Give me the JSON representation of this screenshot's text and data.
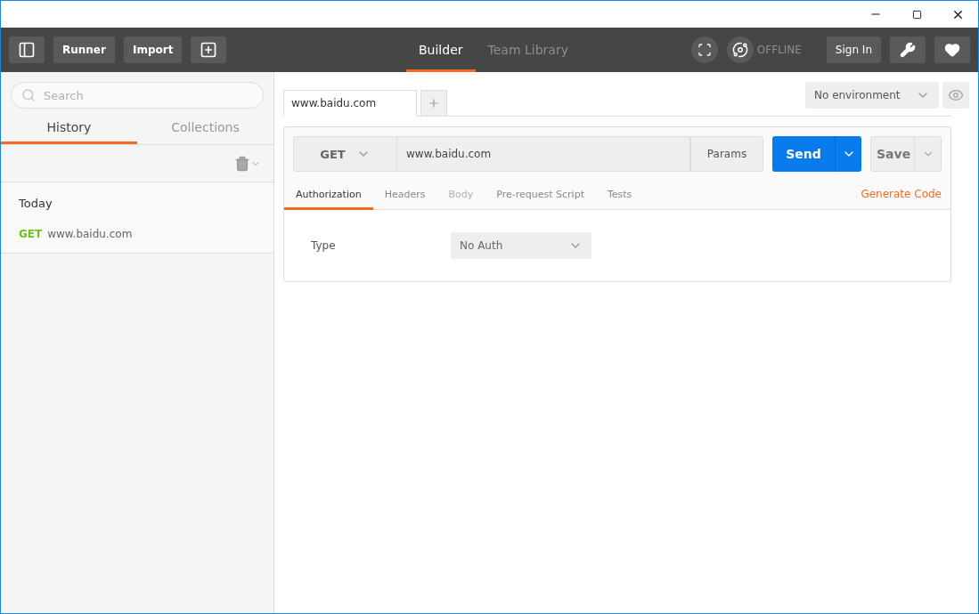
{
  "toolbar": {
    "buttons": [
      "Runner",
      "Import"
    ],
    "nav_tabs": [
      {
        "label": "Builder",
        "selected": true
      },
      {
        "label": "Team Library",
        "selected": false
      }
    ],
    "status": "OFFLINE",
    "sign_in": "Sign In"
  },
  "sidebar": {
    "search": {
      "placeholder": "Search"
    },
    "tabs": [
      {
        "label": "History",
        "selected": true
      },
      {
        "label": "Collections",
        "selected": false
      }
    ],
    "history": [
      {
        "label": "Today",
        "items": [
          {
            "method": "GET",
            "url": "www.baidu.com"
          }
        ]
      }
    ]
  },
  "request_tabs": [
    {
      "label": "www.baidu.com",
      "selected": true
    }
  ],
  "environment": "No environment",
  "request": {
    "method": "GET",
    "url": "www.baidu.com",
    "params": "Params",
    "send": "Send",
    "save": "Save",
    "tabs": [
      {
        "label": "Authorization",
        "selected": true,
        "disabled": false
      },
      {
        "label": "Headers",
        "selected": false,
        "disabled": false
      },
      {
        "label": "Body",
        "selected": false,
        "disabled": true
      },
      {
        "label": "Pre-request Script",
        "selected": false,
        "disabled": false
      },
      {
        "label": "Tests",
        "selected": false,
        "disabled": false
      }
    ],
    "generate_code": "Generate Code",
    "auth": {
      "label": "Type",
      "value": "No Auth"
    }
  }
}
